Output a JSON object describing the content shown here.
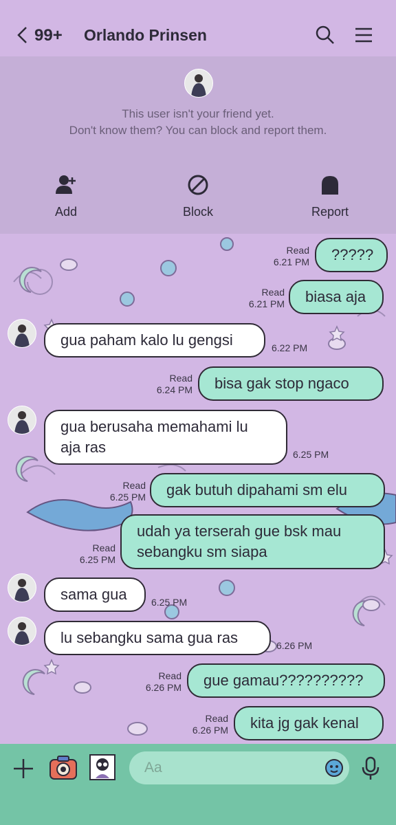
{
  "header": {
    "unread_count": "99+",
    "contact_name": "Orlando Prinsen"
  },
  "notice": {
    "line1": "This user isn't your friend yet.",
    "line2": "Don't know them? You can block and report them.",
    "actions": [
      {
        "label": "Add",
        "icon": "add-friend-icon"
      },
      {
        "label": "Block",
        "icon": "block-icon"
      },
      {
        "label": "Report",
        "icon": "report-icon"
      }
    ]
  },
  "messages": [
    {
      "dir": "out",
      "text": "?????",
      "read": "Read",
      "time": "6.21 PM"
    },
    {
      "dir": "out",
      "text": "biasa aja",
      "read": "Read",
      "time": "6.21 PM"
    },
    {
      "dir": "in",
      "text": "gua paham kalo lu gengsi",
      "time": "6.22 PM"
    },
    {
      "dir": "out",
      "text": "bisa gak stop ngaco",
      "read": "Read",
      "time": "6.24 PM"
    },
    {
      "dir": "in",
      "lines": [
        "gua berusaha memahami lu",
        "aja ras"
      ],
      "time": "6.25 PM"
    },
    {
      "dir": "out",
      "text": "gak butuh dipahami sm elu",
      "read": "Read",
      "time": "6.25 PM"
    },
    {
      "dir": "out",
      "lines": [
        "udah ya terserah gue bsk mau",
        "sebangku sm siapa"
      ],
      "read": "Read",
      "time": "6.25 PM"
    },
    {
      "dir": "in",
      "text": "sama gua",
      "time": "6.25 PM"
    },
    {
      "dir": "in",
      "text": "lu sebangku sama gua ras",
      "time": "6.26 PM"
    },
    {
      "dir": "out",
      "text": "gue gamau??????????",
      "read": "Read",
      "time": "6.26 PM"
    },
    {
      "dir": "out",
      "text": "kita jg gak kenal",
      "read": "Read",
      "time": "6.26 PM"
    }
  ],
  "composer": {
    "placeholder": "Aa"
  },
  "colors": {
    "background": "#d2b7e4",
    "notice_panel": "#c5afd7",
    "outgoing_bubble": "#a6e7d3",
    "incoming_bubble": "#ffffff",
    "bottom_bar": "#74c4a6"
  }
}
